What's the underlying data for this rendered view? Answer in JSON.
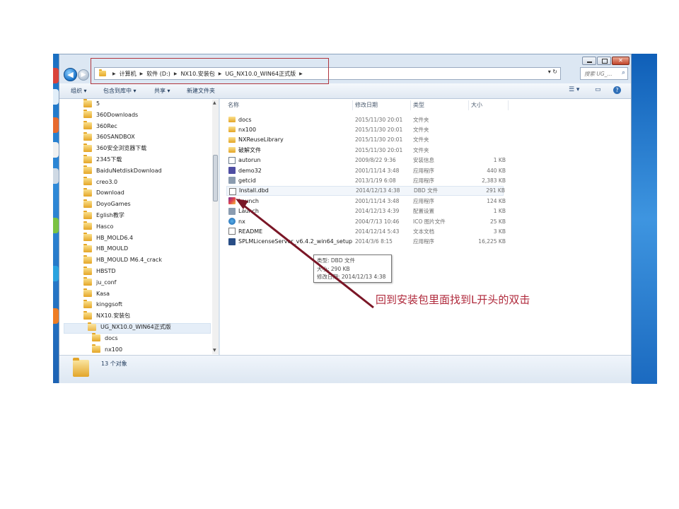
{
  "window": {
    "close_label": "✕",
    "nav": {
      "back_glyph": "◀",
      "fwd_glyph": "▶"
    },
    "breadcrumb": [
      "计算机",
      "软件 (D:)",
      "NX10.安装包",
      "UG_NX10.0_WIN64正式版"
    ],
    "search_placeholder": "搜索 UG_...",
    "address_buttons": "▾  ↻"
  },
  "toolbar": {
    "organize": "组织 ▾",
    "include_library": "包含到库中 ▾",
    "share": "共享 ▾",
    "new_folder": "新建文件夹",
    "view_glyph": "☰ ▾",
    "pane_glyph": "▭",
    "help_glyph": "?"
  },
  "tree": [
    "5",
    "360Downloads",
    "360Rec",
    "360SANDBOX",
    "360安全浏览器下载",
    "2345下载",
    "BaiduNetdiskDownload",
    "creo3.0",
    "Download",
    "DoyoGames",
    "Eglish教学",
    "Hasco",
    "HB_MOLD6.4",
    "HB_MOULD",
    "HB_MOULD M6.4_crack",
    "HBSTD",
    "ju_conf",
    "Kasa",
    "kinggsoft",
    "NX10.安装包",
    "UG_NX10.0_WIN64正式版",
    "docs",
    "nx100"
  ],
  "columns": {
    "name": "名称",
    "date": "修改日期",
    "type": "类型",
    "size": "大小"
  },
  "files": [
    {
      "name": "docs",
      "date": "2015/11/30 20:01",
      "type": "文件夹",
      "size": "",
      "icon": "folder"
    },
    {
      "name": "nx100",
      "date": "2015/11/30 20:01",
      "type": "文件夹",
      "size": "",
      "icon": "folder"
    },
    {
      "name": "NXReuseLibrary",
      "date": "2015/11/30 20:01",
      "type": "文件夹",
      "size": "",
      "icon": "folder"
    },
    {
      "name": "破解文件",
      "date": "2015/11/30 20:01",
      "type": "文件夹",
      "size": "",
      "icon": "folder"
    },
    {
      "name": "autorun",
      "date": "2009/8/22 9:36",
      "type": "安装信息",
      "size": "1 KB",
      "icon": "inf"
    },
    {
      "name": "demo32",
      "date": "2001/11/14 3:48",
      "type": "应用程序",
      "size": "440 KB",
      "icon": "exe"
    },
    {
      "name": "getcid",
      "date": "2013/1/19 6:08",
      "type": "应用程序",
      "size": "2,383 KB",
      "icon": "gear"
    },
    {
      "name": "Install.dbd",
      "date": "2014/12/13 4:38",
      "type": "DBD 文件",
      "size": "291 KB",
      "icon": "doc"
    },
    {
      "name": "Launch",
      "date": "2001/11/14 3:48",
      "type": "应用程序",
      "size": "124 KB",
      "icon": "launch"
    },
    {
      "name": "Launch",
      "date": "2014/12/13 4:39",
      "type": "配置设置",
      "size": "1 KB",
      "icon": "gear"
    },
    {
      "name": "nx",
      "date": "2004/7/13 10:46",
      "type": "ICO 图片文件",
      "size": "25 KB",
      "icon": "ico"
    },
    {
      "name": "README",
      "date": "2014/12/14 5:43",
      "type": "文本文档",
      "size": "3 KB",
      "icon": "doc"
    },
    {
      "name": "SPLMLicenseServer_v6.4.2_win64_setup",
      "date": "2014/3/6 8:15",
      "type": "应用程序",
      "size": "16,225 KB",
      "icon": "splm"
    }
  ],
  "tooltip": {
    "type": "类型: DBD 文件",
    "size": "大小: 290 KB",
    "modified": "修改日期: 2014/12/13 4:38"
  },
  "status": {
    "count": "13 个对象"
  },
  "annotation": "回到安装包里面找到L开头的双击",
  "colors": {
    "annotation": "#b02a3c",
    "highlight_box": "#b1353d",
    "arrow": "#7a1626"
  }
}
